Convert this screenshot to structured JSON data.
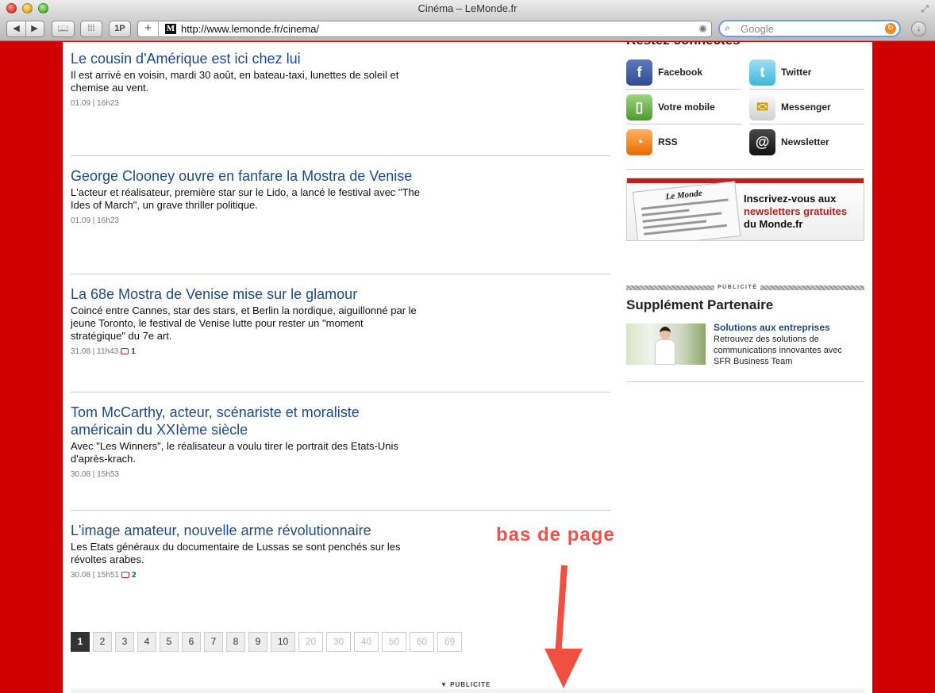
{
  "window": {
    "title": "Cinéma – LeMonde.fr"
  },
  "toolbar": {
    "back_glyph": "◀",
    "forward_glyph": "▶",
    "bookmarks_glyph": "📖",
    "topsites_glyph": "⁞⁞⁞",
    "onep_label": "1P",
    "add_glyph": "+",
    "favicon_text": "M",
    "url": "http://www.lemonde.fr/cinema/",
    "spinner_glyph": "✺",
    "search_placeholder": "Google",
    "search_glyph": "⌕",
    "search_clear_glyph": "↻",
    "download_glyph": "↓"
  },
  "articles": [
    {
      "title": "Le cousin d'Amérique est ici chez lui",
      "summary": "Il est arrivé en voisin, mardi 30 août, en bateau-taxi, lunettes de soleil et chemise au vent.",
      "meta": "01.09 | 16h23",
      "comments": ""
    },
    {
      "title": "George Clooney ouvre en fanfare la Mostra de Venise",
      "summary": "L'acteur et réalisateur, première star sur le Lido, a lancé le festival avec \"The Ides of March\", un grave thriller politique.",
      "meta": "01.09 | 16h23",
      "comments": ""
    },
    {
      "title": "La 68e Mostra de Venise mise sur le glamour",
      "summary": "Coincé entre Cannes, star des stars, et Berlin la nordique, aiguillonné par le jeune Toronto, le festival de Venise lutte pour rester un \"moment stratégique\" du 7e art.",
      "meta": "31.08 | 11h43",
      "comments": "1"
    },
    {
      "title": "Tom McCarthy, acteur, scénariste et moraliste américain du XXIème siècle",
      "summary": "Avec \"Les Winners\", le réalisateur a voulu tirer le portrait des Etats-Unis d'après-krach.",
      "meta": "30.08 | 15h53",
      "comments": ""
    },
    {
      "title": "L'image amateur, nouvelle arme révolutionnaire",
      "summary": "Les Etats généraux du documentaire de Lussas se sont penchés sur les révoltes arabes.",
      "meta": "30.08 | 15h51",
      "comments": "2"
    }
  ],
  "pagination": {
    "pages": [
      "1",
      "2",
      "3",
      "4",
      "5",
      "6",
      "7",
      "8",
      "9",
      "10",
      "20",
      "30",
      "40",
      "50",
      "60",
      "69"
    ],
    "active": "1"
  },
  "annotation": {
    "text": "bas de page"
  },
  "publicite_bottom": "▼ PUBLICITE",
  "sidebar": {
    "title": "Restez connectés",
    "social": [
      {
        "label": "Facebook",
        "glyph": "f"
      },
      {
        "label": "Twitter",
        "glyph": "t"
      },
      {
        "label": "Votre mobile",
        "glyph": "▯"
      },
      {
        "label": "Messenger",
        "glyph": "✉"
      },
      {
        "label": "RSS",
        "glyph": "◔"
      },
      {
        "label": "Newsletter",
        "glyph": "@"
      }
    ],
    "newsletter": {
      "paper_logo": "Le Monde",
      "line1": "Inscrivez-vous aux",
      "line2": "newsletters gratuites",
      "line3": "du Monde.fr"
    },
    "publicite_label": "PUBLICITÉ",
    "supplement": {
      "title": "Supplément Partenaire",
      "link": "Solutions aux entreprises",
      "text": "Retrouvez des solutions de communications innovantes avec SFR Business Team"
    }
  }
}
